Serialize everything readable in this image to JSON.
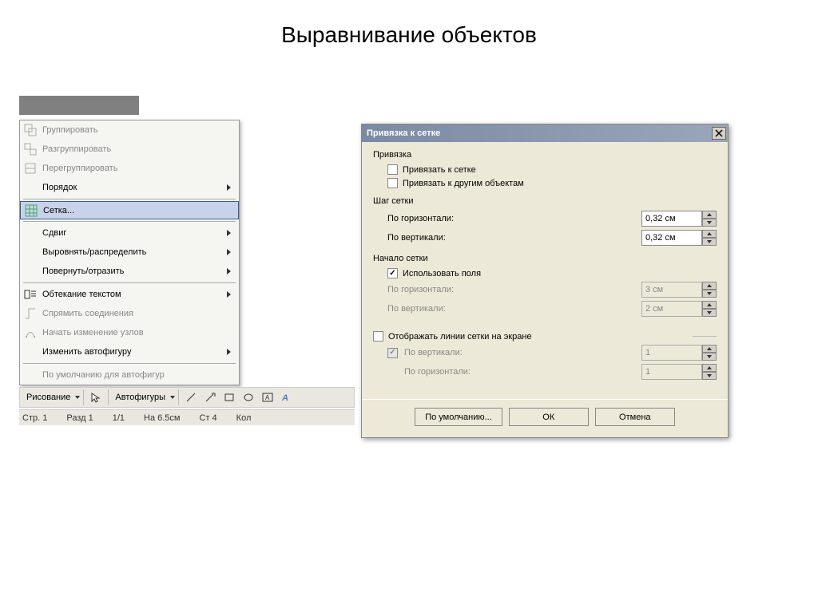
{
  "title": "Выравнивание объектов",
  "menu": {
    "items": [
      {
        "label": "Группировать",
        "disabled": true,
        "icon": "group-icon"
      },
      {
        "label": "Разгруппировать",
        "disabled": true,
        "icon": "ungroup-icon"
      },
      {
        "label": "Перегруппировать",
        "disabled": true,
        "icon": "regroup-icon"
      },
      {
        "label": "Порядок",
        "submenu": true
      },
      {
        "separator": true
      },
      {
        "label": "Сетка...",
        "highlighted": true,
        "icon": "grid-icon"
      },
      {
        "separator": true
      },
      {
        "label": "Сдвиг",
        "submenu": true
      },
      {
        "label": "Выровнять/распределить",
        "submenu": true
      },
      {
        "label": "Повернуть/отразить",
        "submenu": true
      },
      {
        "separator": true
      },
      {
        "label": "Обтекание текстом",
        "submenu": true,
        "icon": "wrap-text-icon"
      },
      {
        "label": "Спрямить соединения",
        "disabled": true,
        "icon": "connector-icon"
      },
      {
        "label": "Начать изменение узлов",
        "disabled": true,
        "icon": "edit-points-icon"
      },
      {
        "label": "Изменить автофигуру",
        "submenu": true
      },
      {
        "separator": true
      },
      {
        "label": "По умолчанию для автофигур",
        "disabled": true
      }
    ]
  },
  "drawing_toolbar": {
    "drawing_label": "Рисование",
    "autoshapes_label": "Автофигуры"
  },
  "status_bar": {
    "page": "Стр. 1",
    "section": "Разд 1",
    "pages": "1/1",
    "at": "На 6.5см",
    "line": "Ст 4",
    "column": "Кол"
  },
  "dialog": {
    "title": "Привязка к сетке",
    "group_snap": "Привязка",
    "snap_to_grid": "Привязать к сетке",
    "snap_to_objects": "Привязать к другим объектам",
    "group_spacing": "Шаг сетки",
    "horizontal_label": "По горизонтали:",
    "vertical_label": "По вертикали:",
    "spacing_h_value": "0,32 см",
    "spacing_v_value": "0,32 см",
    "group_origin": "Начало сетки",
    "use_margins": "Использовать поля",
    "origin_h_value": "3 см",
    "origin_v_value": "2 см",
    "display_grid": "Отображать линии сетки на экране",
    "display_v_label": "По вертикали:",
    "display_h_label": "По горизонтали:",
    "display_v_value": "1",
    "display_h_value": "1",
    "btn_default": "По умолчанию...",
    "btn_ok": "ОК",
    "btn_cancel": "Отмена"
  }
}
